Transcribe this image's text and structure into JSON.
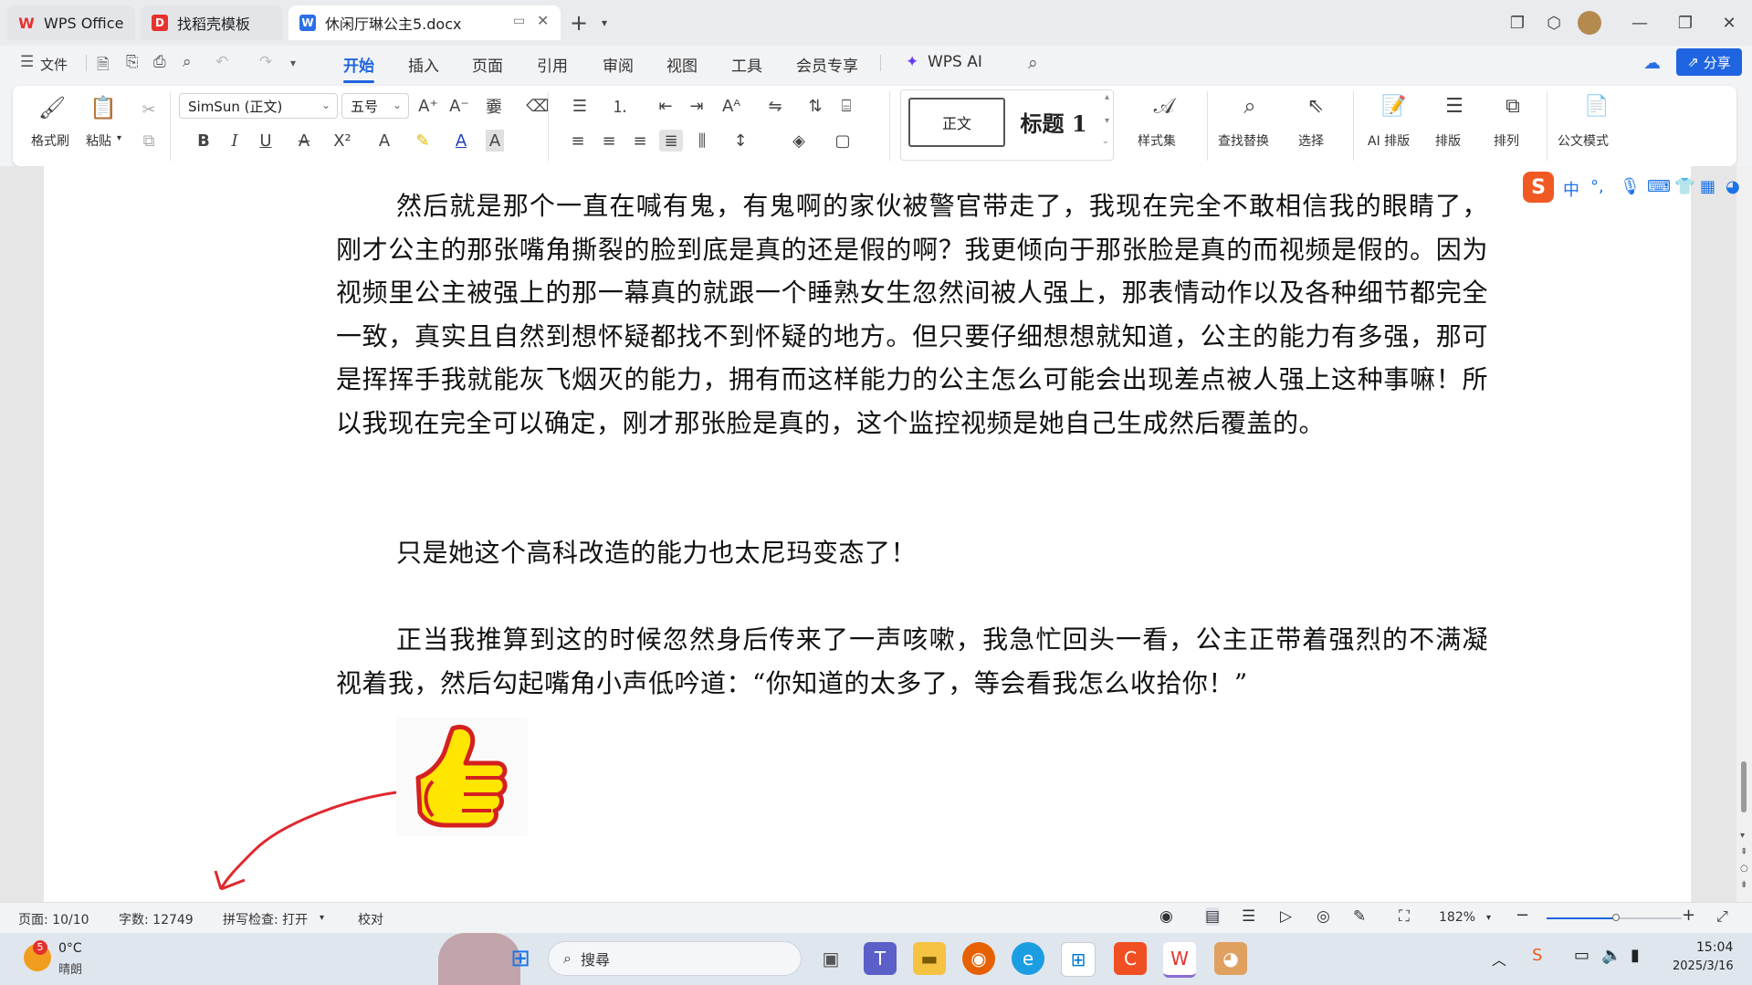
{
  "tabs": [
    {
      "label": "WPS Office",
      "icon": "wps-logo-icon"
    },
    {
      "label": "找稻壳模板",
      "icon": "docer-icon"
    },
    {
      "label": "休闲厅琳公主5.docx",
      "icon": "word-doc-icon"
    }
  ],
  "menu": {
    "file": "文件",
    "items": [
      "开始",
      "插入",
      "页面",
      "引用",
      "审阅",
      "视图",
      "工具",
      "会员专享"
    ],
    "active": "开始",
    "wps_ai": "WPS AI",
    "share": "分享"
  },
  "ribbon": {
    "format_painter": "格式刷",
    "paste": "粘贴",
    "font_name": "SimSun (正文)",
    "font_size": "五号",
    "style_normal": "正文",
    "style_heading": "标题 1",
    "style_set": "样式集",
    "find_replace": "查找替换",
    "select": "选择",
    "ai_layout": "AI 排版",
    "layout": "排版",
    "arrange": "排列",
    "official_mode": "公文模式",
    "bold": "B",
    "italic": "I",
    "underline": "U"
  },
  "document": {
    "paragraphs": [
      "然后就是那个一直在喊有鬼，有鬼啊的家伙被警官带走了，我现在完全不敢相信我的眼睛了，刚才公主的那张嘴角撕裂的脸到底是真的还是假的啊？我更倾向于那张脸是真的而视频是假的。因为视频里公主被强上的那一幕真的就跟一个睡熟女生忽然间被人强上，那表情动作以及各种细节都完全一致，真实且自然到想怀疑都找不到怀疑的地方。但只要仔细想想就知道，公主的能力有多强，那可是挥挥手我就能灰飞烟灭的能力，拥有而这样能力的公主怎么可能会出现差点被人强上这种事嘛！所以我现在完全可以确定，刚才那张脸是真的，这个监控视频是她自己生成然后覆盖的。",
      "只是她这个高科改造的能力也太尼玛变态了！",
      "正当我推算到这的时候忽然身后传来了一声咳嗽，我急忙回头一看，公主正带着强烈的不满凝视着我，然后勾起嘴角小声低吟道：“你知道的太多了，等会看我怎么收拾你！”"
    ]
  },
  "ime": {
    "mode": "中"
  },
  "status": {
    "page": "页面: 10/10",
    "word_count": "字数: 12749",
    "spell_check": "拼写检查: 打开",
    "proofread": "校对",
    "zoom": "182%"
  },
  "taskbar": {
    "weather_temp": "0°C",
    "weather_desc": "晴朗",
    "weather_badge": "5",
    "search_placeholder": "搜尋",
    "time": "15:04",
    "date": "2025/3/16"
  },
  "colors": {
    "accent": "#1f64e0",
    "wps_red": "#e8322e",
    "thumb_yellow": "#ffe600",
    "arrow_red": "#e0282e"
  }
}
